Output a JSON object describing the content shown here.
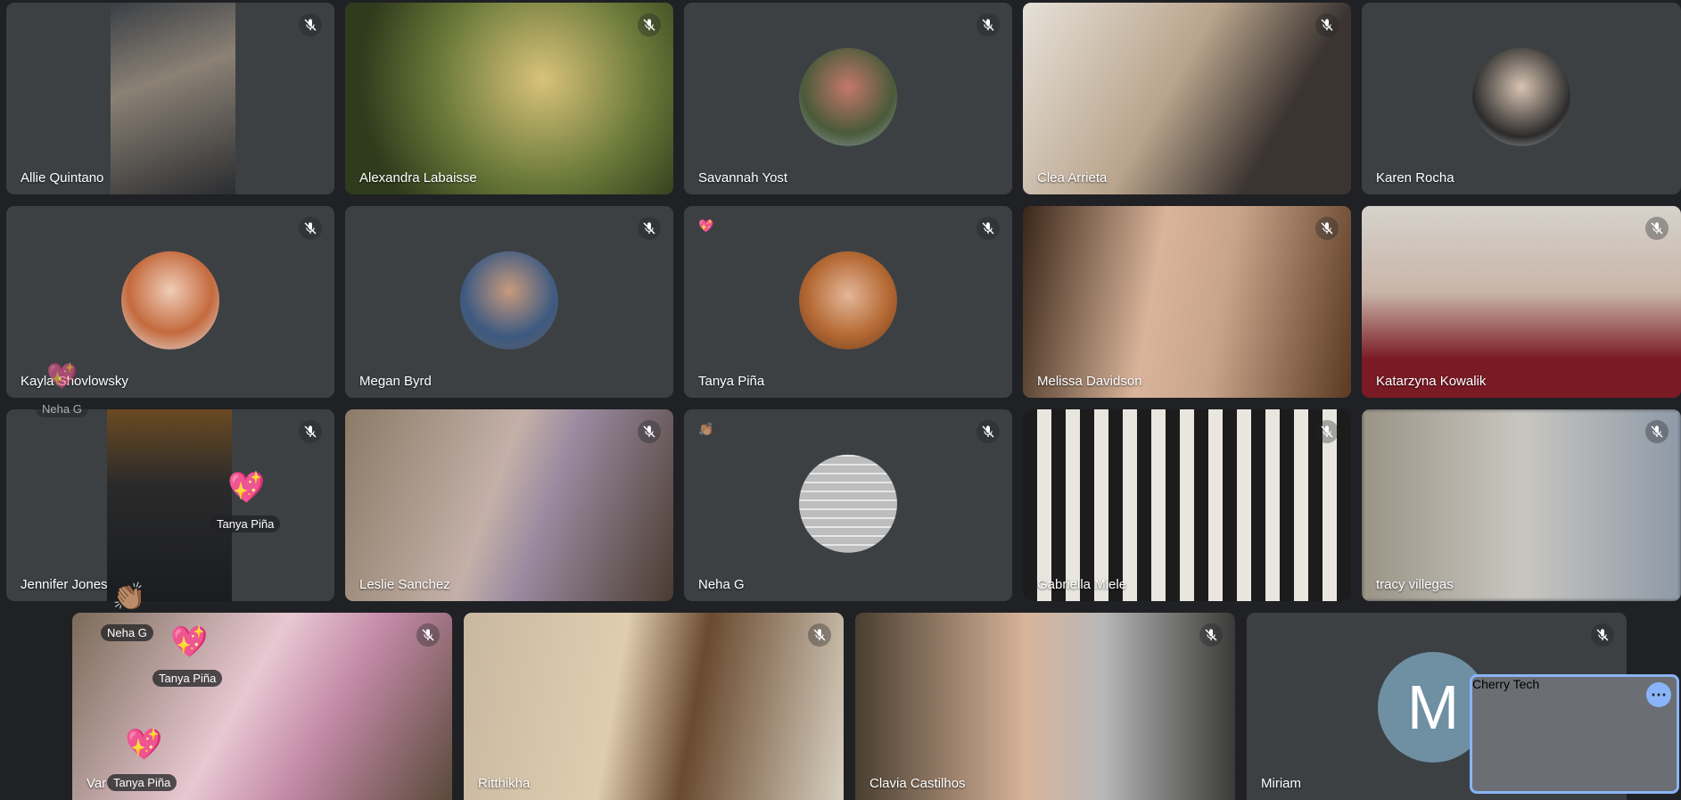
{
  "participants": [
    {
      "name": "Allie Quintano"
    },
    {
      "name": "Alexandra Labaisse"
    },
    {
      "name": "Savannah Yost"
    },
    {
      "name": "Clea Arrieta"
    },
    {
      "name": "Karen Rocha"
    },
    {
      "name": "Kayla Shovlowsky"
    },
    {
      "name": "Megan Byrd"
    },
    {
      "name": "Tanya Piña"
    },
    {
      "name": "Melissa Davidson"
    },
    {
      "name": "Katarzyna Kowalik"
    },
    {
      "name": "Jennifer Jones"
    },
    {
      "name": "Leslie Sanchez"
    },
    {
      "name": "Neha G"
    },
    {
      "name": "Gabriella Miele"
    },
    {
      "name": "tracy villegas"
    },
    {
      "name": "Var"
    },
    {
      "name": "Ritthikha"
    },
    {
      "name": "Clavia Castilhos"
    },
    {
      "name": "Miriam",
      "initial": "M"
    }
  ],
  "self_view": {
    "name": "Cherry Tech",
    "more_icon": "more-options-icon"
  },
  "floating_reactions": [
    {
      "label": "Neha G",
      "emoji": "💖"
    },
    {
      "label": "Tanya Piña",
      "emoji": "💖"
    },
    {
      "label": "Neha G",
      "emoji": "👏🏽"
    },
    {
      "label": "Tanya Piña",
      "emoji": "💖"
    },
    {
      "label": "Tanya Piña",
      "emoji": "💖"
    }
  ],
  "tile_reactions": {
    "tanya": "💖",
    "neha": "👏🏽"
  },
  "icons": {
    "mute": "mic-off-icon"
  },
  "colors": {
    "background": "#202124",
    "tile": "#3c4043",
    "self_border": "#8ab4f8",
    "miriam_avatar": "#6f8fa3"
  }
}
